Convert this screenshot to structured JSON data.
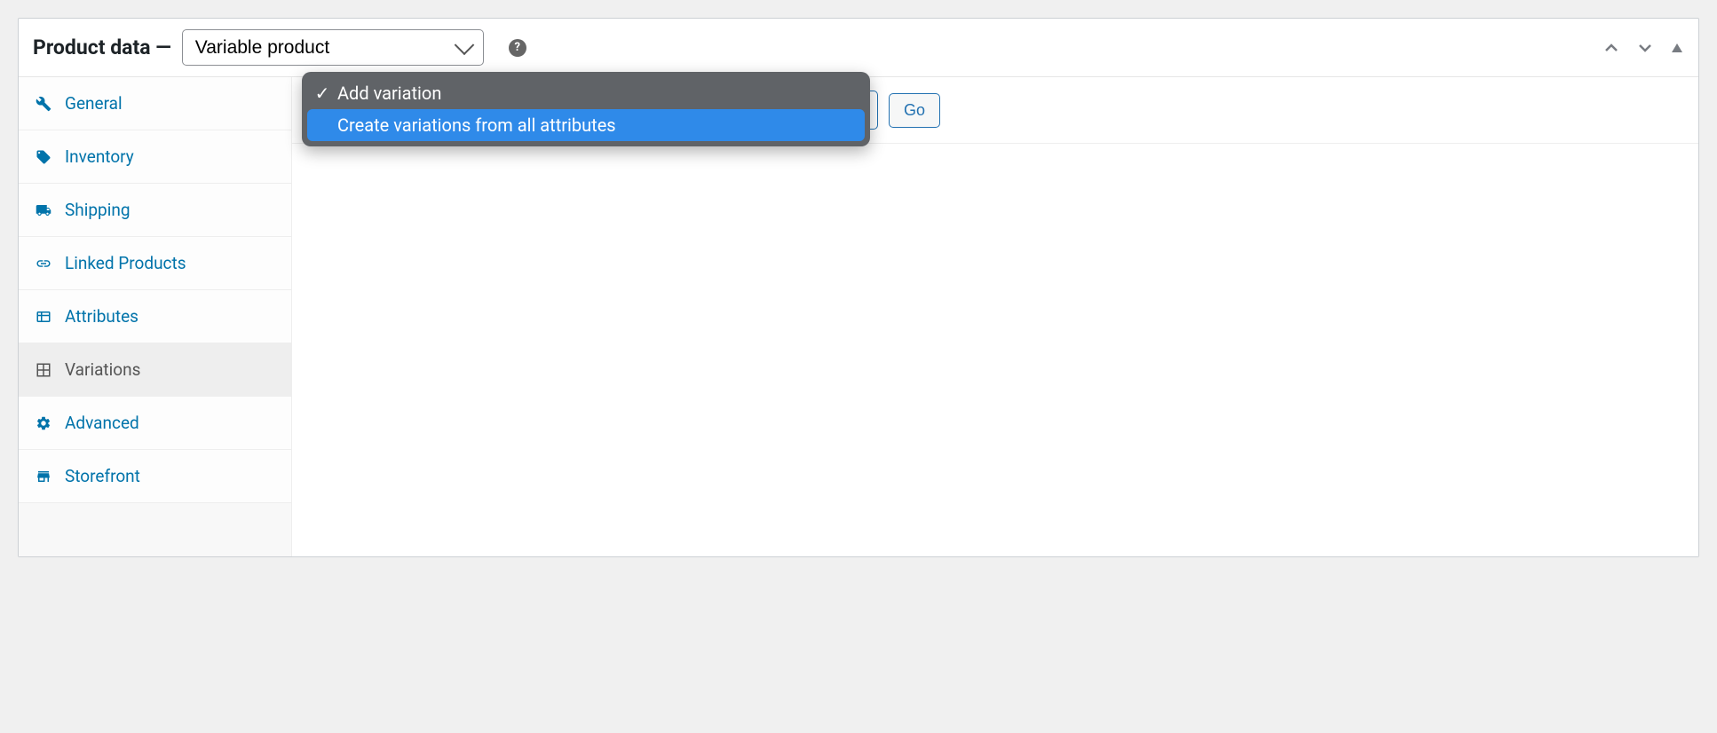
{
  "header": {
    "title": "Product data —",
    "product_type_selected": "Variable product"
  },
  "sidebar": {
    "items": [
      {
        "label": "General",
        "icon": "wrench",
        "active": false
      },
      {
        "label": "Inventory",
        "icon": "tag",
        "active": false
      },
      {
        "label": "Shipping",
        "icon": "truck",
        "active": false
      },
      {
        "label": "Linked Products",
        "icon": "link",
        "active": false
      },
      {
        "label": "Attributes",
        "icon": "list",
        "active": false
      },
      {
        "label": "Variations",
        "icon": "grid",
        "active": true
      },
      {
        "label": "Advanced",
        "icon": "gear",
        "active": false
      },
      {
        "label": "Storefront",
        "icon": "store",
        "active": false
      }
    ]
  },
  "toolbar": {
    "go_label": "Go"
  },
  "dropdown": {
    "items": [
      {
        "label": "Add variation",
        "selected": true,
        "highlighted": false
      },
      {
        "label": "Create variations from all attributes",
        "selected": false,
        "highlighted": true
      }
    ]
  }
}
